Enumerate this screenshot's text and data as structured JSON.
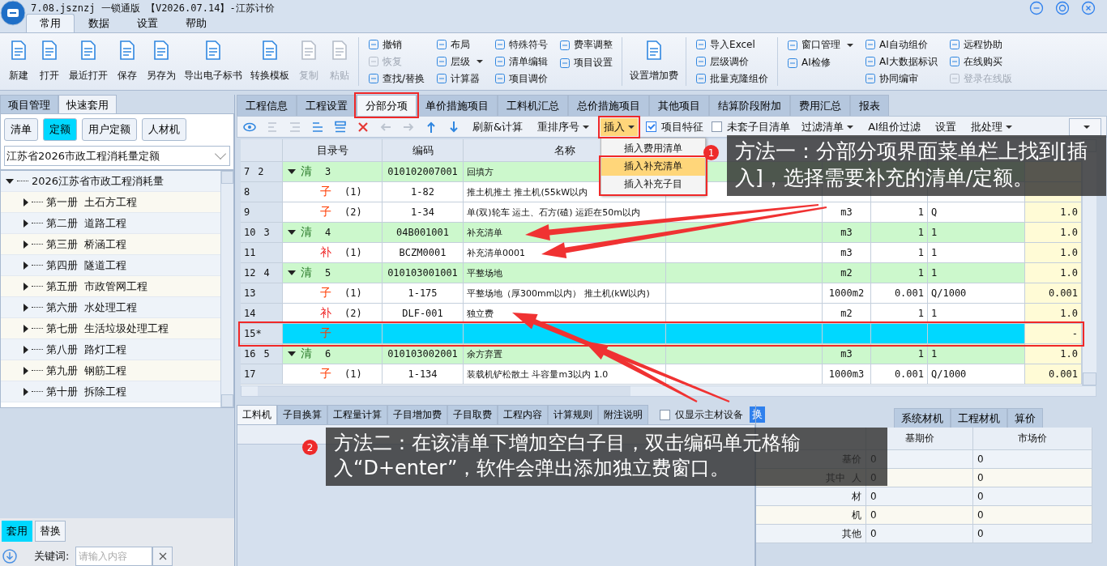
{
  "window": {
    "title": "7.08.jsznzj 一锁通版 【V2026.07.14】-江苏计价"
  },
  "menu_tabs": [
    {
      "label": "常用",
      "selected": true
    },
    {
      "label": "数据",
      "selected": false
    },
    {
      "label": "设置",
      "selected": false
    },
    {
      "label": "帮助",
      "selected": false
    }
  ],
  "ribbon": [
    {
      "kind": "large",
      "label": "新建",
      "disabled": false
    },
    {
      "kind": "large",
      "label": "打开",
      "disabled": false
    },
    {
      "kind": "large",
      "label": "最近打开",
      "disabled": false
    },
    {
      "kind": "large",
      "label": "保存",
      "disabled": false
    },
    {
      "kind": "large",
      "label": "另存为",
      "disabled": false
    },
    {
      "kind": "large",
      "label": "导出电子标书",
      "disabled": false
    },
    {
      "kind": "large",
      "label": "转换模板",
      "disabled": false
    },
    {
      "kind": "large",
      "label": "复制",
      "disabled": true
    },
    {
      "kind": "large",
      "label": "粘贴",
      "disabled": true
    },
    {
      "kind": "column",
      "items": [
        {
          "label": "撤销",
          "disabled": false
        },
        {
          "label": "恢复",
          "disabled": true
        },
        {
          "label": "查找/替换",
          "disabled": false
        }
      ]
    },
    {
      "kind": "column",
      "items": [
        {
          "label": "布局",
          "disabled": false
        },
        {
          "label": "层级",
          "disabled": false,
          "dropdown": true
        },
        {
          "label": "计算器",
          "disabled": false
        }
      ]
    },
    {
      "kind": "column",
      "items": [
        {
          "label": "特殊符号",
          "disabled": false
        },
        {
          "label": "清单编辑",
          "disabled": false
        },
        {
          "label": "项目调价",
          "disabled": false
        }
      ]
    },
    {
      "kind": "column",
      "items": [
        {
          "label": "费率调整",
          "disabled": false
        },
        {
          "label": "项目设置",
          "disabled": false
        }
      ]
    },
    {
      "kind": "large",
      "label": "设置增加费",
      "disabled": false
    },
    {
      "kind": "column",
      "items": [
        {
          "label": "导入Excel",
          "disabled": false
        },
        {
          "label": "层级调价",
          "disabled": false
        },
        {
          "label": "批量克隆组价",
          "disabled": false
        }
      ]
    },
    {
      "kind": "column",
      "items": [
        {
          "label": "窗口管理",
          "disabled": false,
          "dropdown": true
        },
        {
          "label": "AI检修",
          "disabled": false
        }
      ]
    },
    {
      "kind": "column",
      "items": [
        {
          "label": "AI自动组价",
          "disabled": false
        },
        {
          "label": "AI大数据标识",
          "disabled": false
        },
        {
          "label": "协同编审",
          "disabled": false
        }
      ]
    },
    {
      "kind": "column",
      "items": [
        {
          "label": "远程协助",
          "disabled": false
        },
        {
          "label": "在线购买",
          "disabled": false
        },
        {
          "label": "登录在线版",
          "disabled": true
        }
      ]
    }
  ],
  "left_panel": {
    "tabs": [
      {
        "label": "项目管理",
        "selected": false
      },
      {
        "label": "快速套用",
        "selected": true
      }
    ],
    "filters": [
      {
        "label": "清单",
        "selected": false
      },
      {
        "label": "定额",
        "selected": true
      },
      {
        "label": "用户定额",
        "selected": false
      },
      {
        "label": "人材机",
        "selected": false
      }
    ],
    "library": "江苏省2026市政工程消耗量定额",
    "tree": {
      "label": "2026江苏省市政工程消耗量",
      "expanded": true,
      "children": [
        {
          "label": "第一册  土石方工程",
          "expanded": false
        },
        {
          "label": "第二册  道路工程",
          "expanded": false
        },
        {
          "label": "第三册  桥涵工程",
          "expanded": false
        },
        {
          "label": "第四册  隧道工程",
          "expanded": false
        },
        {
          "label": "第五册  市政管网工程",
          "expanded": false
        },
        {
          "label": "第六册  水处理工程",
          "expanded": false
        },
        {
          "label": "第七册  生活垃圾处理工程",
          "expanded": false
        },
        {
          "label": "第八册  路灯工程",
          "expanded": false
        },
        {
          "label": "第九册  钢筋工程",
          "expanded": false
        },
        {
          "label": "第十册  拆除工程",
          "expanded": false
        }
      ]
    },
    "actions": [
      {
        "label": "套用",
        "selected": true
      },
      {
        "label": "替换",
        "selected": false
      }
    ],
    "search": {
      "label": "关键词:",
      "placeholder": "请输入内容"
    }
  },
  "main_tabs": [
    {
      "label": "工程信息",
      "selected": false,
      "highlighted": false
    },
    {
      "label": "工程设置",
      "selected": false,
      "highlighted": false
    },
    {
      "label": "分部分项",
      "selected": true,
      "highlighted": true
    },
    {
      "label": "单价措施项目",
      "selected": false,
      "highlighted": false
    },
    {
      "label": "工料机汇总",
      "selected": false,
      "highlighted": false
    },
    {
      "label": "总价措施项目",
      "selected": false,
      "highlighted": false
    },
    {
      "label": "其他项目",
      "selected": false,
      "highlighted": false
    },
    {
      "label": "结算阶段附加",
      "selected": false,
      "highlighted": false
    },
    {
      "label": "费用汇总",
      "selected": false,
      "highlighted": false
    },
    {
      "label": "报表",
      "selected": false,
      "highlighted": false
    }
  ],
  "toolbar": {
    "icon_buttons": [
      {
        "disabled": false
      },
      {
        "disabled": true
      },
      {
        "disabled": true
      },
      {
        "disabled": false
      },
      {
        "disabled": false
      },
      {
        "disabled": false
      },
      {
        "disabled": true
      },
      {
        "disabled": true
      },
      {
        "disabled": false
      },
      {
        "disabled": false
      }
    ],
    "items": [
      {
        "kind": "button",
        "label": "刷新&计算",
        "highlighted": false
      },
      {
        "kind": "dropdown",
        "label": "重排序号",
        "highlighted": false
      },
      {
        "kind": "dropdown",
        "label": "插入",
        "highlighted": true,
        "open": true
      },
      {
        "kind": "checkbox",
        "label": "项目特征",
        "checked": true,
        "highlighted": false
      },
      {
        "kind": "checkbox",
        "label": "未套子目清单",
        "checked": false,
        "highlighted": false
      },
      {
        "kind": "dropdown",
        "label": "过滤清单",
        "highlighted": false
      },
      {
        "kind": "button",
        "label": "AI组价过滤",
        "highlighted": false
      },
      {
        "kind": "button",
        "label": "设置",
        "highlighted": false
      },
      {
        "kind": "dropdown",
        "label": "批处理",
        "highlighted": false
      }
    ],
    "insert_menu": [
      {
        "label": "插入费用清单",
        "selected": false,
        "highlighted": false
      },
      {
        "label": "插入补充清单",
        "selected": true,
        "highlighted": true
      },
      {
        "label": "插入补充子目",
        "selected": false,
        "highlighted": true
      }
    ]
  },
  "table": {
    "columns": [
      "目录号",
      "编码",
      "名称"
    ],
    "rows": [
      {
        "num": "7",
        "seq": "2",
        "kind": "list",
        "mark": "清",
        "number": "3",
        "expanded": true,
        "code": "010102007001",
        "name": "回填方",
        "selected": false,
        "highlighted": false
      },
      {
        "num": "8",
        "kind": "item",
        "mark": "子",
        "number": "(1)",
        "code": "1-82",
        "name": "推土机推土 推土机(55kW以内",
        "selected": false,
        "highlighted": false
      },
      {
        "num": "9",
        "kind": "item",
        "mark": "子",
        "number": "(2)",
        "code": "1-34",
        "name": "单(双)轮车 运土、石方(碴) 运距在50m以内",
        "unit": "m3",
        "qty": "1",
        "expr": "Q",
        "total": "1.0",
        "selected": false,
        "highlighted": false
      },
      {
        "num": "10",
        "seq": "3",
        "kind": "list",
        "mark": "清",
        "number": "4",
        "expanded": true,
        "code": "04B001001",
        "name": "补充清单",
        "unit": "m3",
        "qty": "1",
        "expr": "1",
        "total": "1.0",
        "selected": false,
        "highlighted": false
      },
      {
        "num": "11",
        "kind": "supplement",
        "mark": "补",
        "number": "(1)",
        "code": "BCZM0001",
        "name": "补充清单0001",
        "unit": "m3",
        "qty": "1",
        "expr": "1",
        "total": "1.0",
        "selected": false,
        "highlighted": false
      },
      {
        "num": "12",
        "seq": "4",
        "kind": "list",
        "mark": "清",
        "number": "5",
        "expanded": true,
        "code": "010103001001",
        "name": "平整场地",
        "unit": "m2",
        "qty": "1",
        "expr": "1",
        "total": "1.0",
        "selected": false,
        "highlighted": false
      },
      {
        "num": "13",
        "kind": "item",
        "mark": "子",
        "number": "(1)",
        "code": "1-175",
        "name": "平整场地（厚300mm以内） 推土机(kW以内)",
        "unit": "1000m2",
        "qty": "0.001",
        "expr": "Q/1000",
        "total": "0.001",
        "selected": false,
        "highlighted": false
      },
      {
        "num": "14",
        "kind": "supplement",
        "mark": "补",
        "number": "(2)",
        "code": "DLF-001",
        "name": "独立费",
        "unit": "m2",
        "qty": "1",
        "expr": "1",
        "total": "1.0",
        "selected": false,
        "highlighted": false
      },
      {
        "num": "15*",
        "kind": "item",
        "mark": "子",
        "total": "-",
        "selected": true,
        "highlighted": true
      },
      {
        "num": "16",
        "seq": "5",
        "kind": "list",
        "mark": "清",
        "number": "6",
        "expanded": true,
        "code": "010103002001",
        "name": "余方弃置",
        "unit": "m3",
        "qty": "1",
        "expr": "1",
        "total": "1.0",
        "selected": false,
        "highlighted": false
      },
      {
        "num": "17",
        "kind": "item",
        "mark": "子",
        "number": "(1)",
        "code": "1-134",
        "name": "装载机铲松散土 斗容量m3以内 1.0",
        "unit": "1000m3",
        "qty": "0.001",
        "expr": "Q/1000",
        "total": "0.001",
        "selected": false,
        "highlighted": false
      }
    ]
  },
  "bottom_tabs": [
    {
      "label": "工料机",
      "selected": true
    },
    {
      "label": "子目换算",
      "selected": false
    },
    {
      "label": "工程量计算",
      "selected": false
    },
    {
      "label": "子目增加费",
      "selected": false
    },
    {
      "label": "子目取费",
      "selected": false
    },
    {
      "label": "工程内容",
      "selected": false
    },
    {
      "label": "计算规则",
      "selected": false
    },
    {
      "label": "附注说明",
      "selected": false
    }
  ],
  "main_material_only": {
    "label": "仅显示主材设备",
    "checked": false
  },
  "swap_button": "换",
  "price_panel": {
    "tabs": [
      {
        "label": "系统材机",
        "selected": false
      },
      {
        "label": "工程材机",
        "selected": false
      },
      {
        "label": "算价",
        "selected": false
      }
    ],
    "columns": [
      "基期价",
      "市场价"
    ],
    "rows": [
      {
        "label": "基价",
        "base": "0",
        "market": "0"
      },
      {
        "label": "其中  人",
        "base": "0",
        "market": "0"
      },
      {
        "label": "材",
        "base": "0",
        "market": "0"
      },
      {
        "label": "机",
        "base": "0",
        "market": "0"
      },
      {
        "label": "其他",
        "base": "0",
        "market": "0"
      }
    ]
  },
  "callouts": [
    {
      "badge": "1",
      "text": "方法一：分部分项界面菜单栏上找到[插入]，选择需要补充的清单/定额。"
    },
    {
      "badge": "2",
      "text": "方法二：在该清单下增加空白子目，双击编码单元格输入“D+enter”，软件会弹出添加独立费窗口。"
    }
  ]
}
